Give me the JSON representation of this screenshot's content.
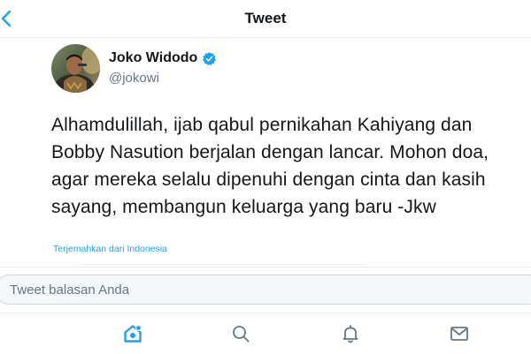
{
  "header": {
    "title": "Tweet",
    "back_icon": "chevron-left-icon"
  },
  "author": {
    "name": "Joko Widodo",
    "handle": "@jokowi",
    "verified": true,
    "verified_icon": "verified-badge-icon"
  },
  "tweet": {
    "text": "Alhamdulillah, ijab qabul pernikahan Kahiyang dan Bobby Nasution berjalan dengan lancar. Mohon doa, agar mereka selalu dipenuhi dengan cinta dan kasih sayang, membangun keluarga yang baru -Jkw",
    "translate_link": "Terjemahkan dari Indonesia"
  },
  "reply": {
    "placeholder": "Tweet balasan Anda"
  },
  "tabbar": {
    "items": [
      {
        "icon": "home-icon",
        "active": true
      },
      {
        "icon": "search-icon",
        "active": false
      },
      {
        "icon": "bell-icon",
        "active": false
      },
      {
        "icon": "mail-icon",
        "active": false
      }
    ]
  },
  "colors": {
    "accent": "#1da1f2",
    "text": "#14171a",
    "secondary_text": "#657786",
    "border": "#e6ecf0"
  }
}
